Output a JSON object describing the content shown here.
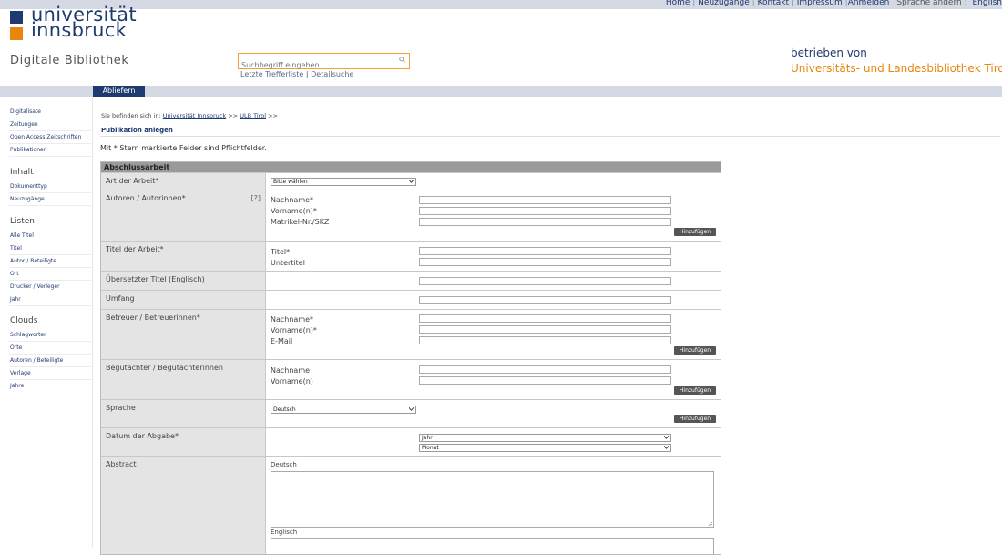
{
  "top_links": {
    "home": "Home",
    "new_items": "Neuzugänge",
    "contact": "Kontakt",
    "imprint": "Impressum",
    "login": "Anmelden",
    "language_label": "Sprache ändern :",
    "language": "English"
  },
  "logo": {
    "line1": "universität",
    "line2": "innsbruck"
  },
  "site_subtitle": "Digitale Bibliothek",
  "search": {
    "placeholder": "Suchbegriff eingeben",
    "last_results": "Letzte Trefferliste",
    "separator": "|",
    "advanced": "Detailsuche"
  },
  "operator": {
    "prefix": "betrieben von",
    "library": "Universitäts- und Landesbibliothek Tirol"
  },
  "nav": {
    "active_tab": "Abliefern"
  },
  "sidebar": {
    "items": [
      "Digitalisate",
      "Zeitungen",
      "Open Access Zeitschriften",
      "Publikationen"
    ],
    "sections": [
      {
        "title": "Inhalt",
        "items": [
          "Dokumenttyp",
          "Neuzugänge"
        ]
      },
      {
        "title": "Listen",
        "items": [
          "Alle Titel",
          "Titel",
          "Autor / Beteiligte",
          "Ort",
          "Drucker / Verleger",
          "Jahr"
        ]
      },
      {
        "title": "Clouds",
        "items": [
          "Schlagworter",
          "Orte",
          "Autoren / Beteiligte",
          "Verlage",
          "Jahre"
        ]
      }
    ]
  },
  "breadcrumb": {
    "prefix": "Sie befinden sich in:",
    "items": [
      "Universität Innsbruck",
      "ULB Tirol"
    ],
    "sep": ">>"
  },
  "page_title": "Publikation anlegen",
  "required_note": "Mit * Stern markierte Felder sind Pflichtfelder.",
  "form": {
    "header": "Abschlussarbeit",
    "type_label": "Art der Arbeit*",
    "type_value": "Bitte wählen",
    "authors_label": "Autoren / Autorinnen*",
    "authors_help": "[?]",
    "authors_fields": [
      "Nachname*",
      "Vorname(n)*",
      "Matrikel-Nr./SKZ"
    ],
    "add_button": "Hinzufügen",
    "title_label": "Titel der Arbeit*",
    "title_fields": [
      "Titel*",
      "Untertitel"
    ],
    "translated_title_label": "Übersetzter Titel (Englisch)",
    "extent_label": "Umfang",
    "supervisors_label": "Betreuer / Betreuerinnen*",
    "supervisors_fields": [
      "Nachname*",
      "Vorname(n)*",
      "E-Mail"
    ],
    "reviewers_label": "Begutachter / Begutachterinnen",
    "reviewers_fields": [
      "Nachname",
      "Vorname(n)"
    ],
    "language_label": "Sprache",
    "language_value": "Deutsch",
    "date_label": "Datum der Abgabe*",
    "date_year": "Jahr",
    "date_month": "Monat",
    "abstract_label": "Abstract",
    "abstract_de": "Deutsch",
    "abstract_en": "Englisch"
  }
}
